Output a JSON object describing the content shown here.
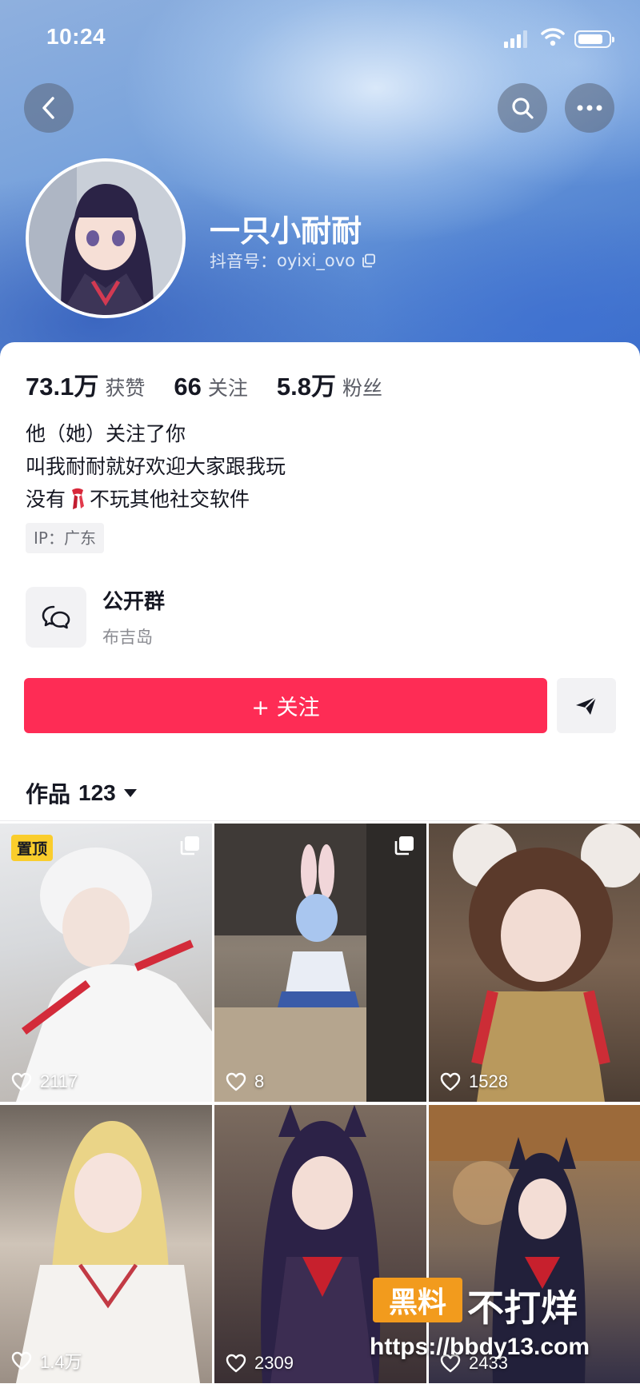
{
  "status_bar": {
    "time": "10:24"
  },
  "profile": {
    "nickname": "一只小耐耐",
    "douyin_id_label": "抖音号：",
    "douyin_id": "oyixi_ovo"
  },
  "stats": [
    {
      "value": "73.1万",
      "label": "获赞"
    },
    {
      "value": "66",
      "label": "关注"
    },
    {
      "value": "5.8万",
      "label": "粉丝"
    }
  ],
  "bio": {
    "line1": "他（她）关注了你",
    "line2": "叫我耐耐就好欢迎大家跟我玩",
    "line3_before": "没有",
    "line3_after": "不玩其他社交软件"
  },
  "ip": "IP：广东",
  "group": {
    "title": "公开群",
    "subtitle": "布吉岛"
  },
  "actions": {
    "follow_label": "+ 关注"
  },
  "works": {
    "label": "作品",
    "count": "123"
  },
  "posts": [
    {
      "likes": "2117",
      "pinned_label": "置顶",
      "multi": true
    },
    {
      "likes": "8",
      "multi": true
    },
    {
      "likes": "1528",
      "multi": false
    },
    {
      "likes": "1.4万",
      "multi": false
    },
    {
      "likes": "2309",
      "multi": false
    },
    {
      "likes": "2433",
      "multi": false
    }
  ],
  "watermark": {
    "box_text": "黑料",
    "title": "不打烊",
    "url": "https://bbdy13.com"
  },
  "colors": {
    "follow": "#fe2c55",
    "pin_badge": "#facd2c",
    "watermark": "#f29b1d"
  }
}
